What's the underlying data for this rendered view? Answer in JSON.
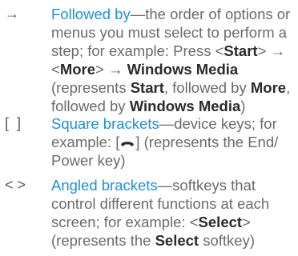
{
  "entries": [
    {
      "symbol": "→",
      "term": "Followed by",
      "dash": "—",
      "text1": "the order of options or menus you must select to perform a step; for example: Press <",
      "k1": "Start",
      "text2": "> → <",
      "k2": "More",
      "text3": "> → ",
      "k3": "Windows Media",
      "text4": " (represents ",
      "k4": "Start",
      "text5": ", followed by ",
      "k5": "More",
      "text6": ", followed by ",
      "k6": "Windows Media",
      "text7": ")"
    },
    {
      "symbol": "[  ]",
      "term": "Square brackets",
      "dash": "—",
      "text1": "device keys; for example: [",
      "icon": "end-power-key-icon",
      "text2": "] (represents the End/ Power key)"
    },
    {
      "symbol": "< >",
      "term": "Angled brackets",
      "dash": "—",
      "text1": "softkeys that control different functions at each screen; for example: <",
      "k1": "Select",
      "text2": "> (represents the ",
      "k2": "Select",
      "text3": " softkey)"
    }
  ],
  "colors": {
    "term": "#1e90d8",
    "body_text": "#6b6b6b",
    "bold_text": "#2b2b2b"
  }
}
